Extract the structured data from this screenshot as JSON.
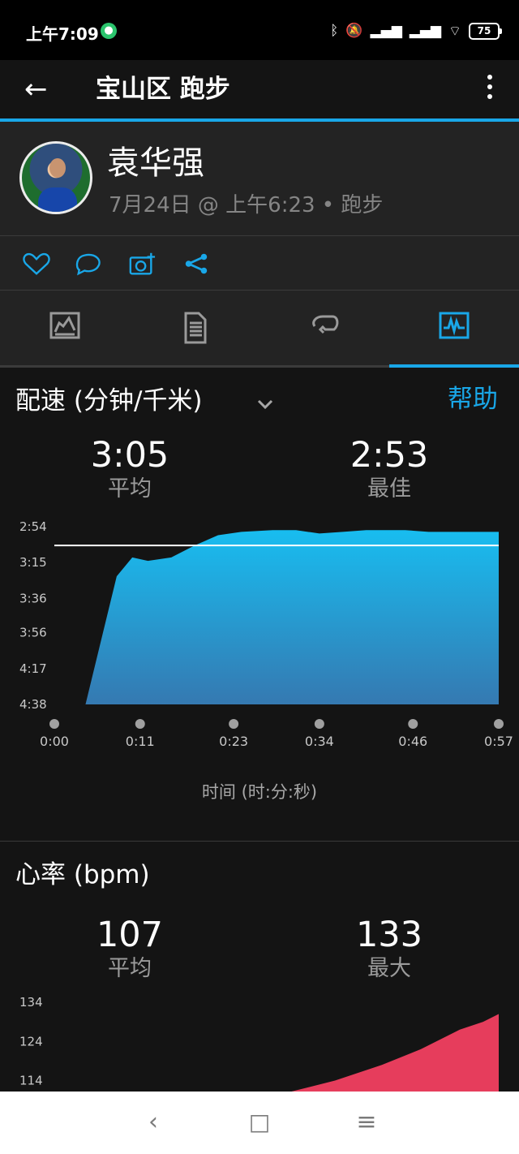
{
  "status_bar": {
    "time": "上午7:09",
    "app_icon": "bubble-icon",
    "bluetooth": "bluetooth-icon",
    "mute": "mute-icon",
    "signal_1": "signal-icon",
    "signal_2": "signal-icon",
    "wifi": "wifi-icon",
    "battery": "75"
  },
  "header": {
    "back_icon": "back-arrow-icon",
    "title": "宝山区 跑步",
    "more_icon": "more-vertical-icon"
  },
  "profile": {
    "name": "袁华强",
    "meta": "7月24日 @ 上午6:23 • 跑步",
    "avatar_icon": "avatar-icon"
  },
  "actions": [
    {
      "name": "like-icon"
    },
    {
      "name": "comment-icon"
    },
    {
      "name": "camera-add-icon"
    },
    {
      "name": "share-icon"
    }
  ],
  "tabs": [
    {
      "name": "map-tab-icon"
    },
    {
      "name": "details-tab-icon"
    },
    {
      "name": "laps-tab-icon"
    },
    {
      "name": "charts-tab-icon"
    }
  ],
  "pace_section": {
    "title": "配速 (分钟/千米)",
    "help": "帮助",
    "avg_value": "3:05",
    "avg_label": "平均",
    "best_value": "2:53",
    "best_label": "最佳",
    "x_axis_label": "时间 (时:分:秒)"
  },
  "heart_section": {
    "title": "心率 (bpm)",
    "avg_value": "107",
    "avg_label": "平均",
    "max_value": "133",
    "max_label": "最大"
  },
  "navigation": {
    "back": "‹",
    "home": "□",
    "menu": "≡"
  },
  "colors": {
    "accent": "#19a7e8",
    "pace_fill_top": "#18bdf0",
    "pace_fill_bottom": "#3579b1",
    "heart_fill": "#e63d5c"
  },
  "chart_data": [
    {
      "type": "area",
      "title": "配速 (分钟/千米)",
      "xlabel": "时间 (时:分:秒)",
      "ylabel": "配速",
      "x_ticks": [
        "0:00",
        "0:11",
        "0:23",
        "0:34",
        "0:46",
        "0:57"
      ],
      "y_ticks": [
        "2:54",
        "3:15",
        "3:36",
        "3:56",
        "4:17",
        "4:38"
      ],
      "ylim": [
        "2:54",
        "4:38"
      ],
      "inverted_y": true,
      "average_line": "3:05",
      "series": [
        {
          "values": [
            {
              "x": "0:04",
              "y": "4:38"
            },
            {
              "x": "0:08",
              "y": "3:23"
            },
            {
              "x": "0:10",
              "y": "3:12"
            },
            {
              "x": "0:12",
              "y": "3:14"
            },
            {
              "x": "0:15",
              "y": "3:12"
            },
            {
              "x": "0:18",
              "y": "3:05"
            },
            {
              "x": "0:21",
              "y": "2:59"
            },
            {
              "x": "0:24",
              "y": "2:57"
            },
            {
              "x": "0:28",
              "y": "2:56"
            },
            {
              "x": "0:31",
              "y": "2:56"
            },
            {
              "x": "0:34",
              "y": "2:58"
            },
            {
              "x": "0:37",
              "y": "2:57"
            },
            {
              "x": "0:40",
              "y": "2:56"
            },
            {
              "x": "0:42",
              "y": "2:56"
            },
            {
              "x": "0:45",
              "y": "2:56"
            },
            {
              "x": "0:48",
              "y": "2:57"
            },
            {
              "x": "0:52",
              "y": "2:57"
            },
            {
              "x": "0:57",
              "y": "2:57"
            }
          ]
        }
      ]
    },
    {
      "type": "area",
      "title": "心率 (bpm)",
      "ylabel": "心率",
      "y_ticks": [
        "134",
        "124",
        "114"
      ],
      "ylim": [
        111,
        134
      ],
      "series": [
        {
          "values": [
            {
              "x": "0:30",
              "y": 111
            },
            {
              "x": "0:36",
              "y": 114
            },
            {
              "x": "0:42",
              "y": 118
            },
            {
              "x": "0:47",
              "y": 122
            },
            {
              "x": "0:52",
              "y": 127
            },
            {
              "x": "0:55",
              "y": 129
            },
            {
              "x": "0:57",
              "y": 131
            }
          ]
        }
      ]
    }
  ]
}
